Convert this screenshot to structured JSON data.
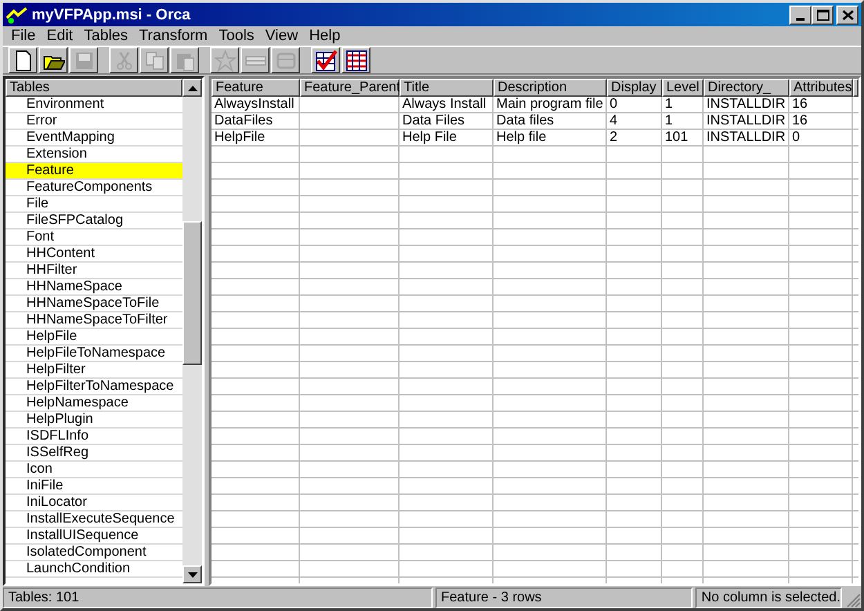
{
  "window": {
    "title": "myVFPApp.msi - Orca"
  },
  "menu": [
    "File",
    "Edit",
    "Tables",
    "Transform",
    "Tools",
    "View",
    "Help"
  ],
  "toolbar": [
    {
      "kind": "new",
      "disabled": false
    },
    {
      "kind": "open",
      "disabled": false
    },
    {
      "kind": "save",
      "disabled": true
    },
    {
      "kind": "cut",
      "disabled": true
    },
    {
      "kind": "copy",
      "disabled": true
    },
    {
      "kind": "paste",
      "disabled": true
    },
    {
      "kind": "star",
      "disabled": true
    },
    {
      "kind": "row",
      "disabled": true
    },
    {
      "kind": "table",
      "disabled": true
    },
    {
      "kind": "validate",
      "disabled": false
    },
    {
      "kind": "merge",
      "disabled": false
    }
  ],
  "tables": {
    "header": "Tables",
    "items": [
      {
        "name": "Environment",
        "selected": false
      },
      {
        "name": "Error",
        "selected": false
      },
      {
        "name": "EventMapping",
        "selected": false
      },
      {
        "name": "Extension",
        "selected": false
      },
      {
        "name": "Feature",
        "selected": true
      },
      {
        "name": "FeatureComponents",
        "selected": false
      },
      {
        "name": "File",
        "selected": false
      },
      {
        "name": "FileSFPCatalog",
        "selected": false
      },
      {
        "name": "Font",
        "selected": false
      },
      {
        "name": "HHContent",
        "selected": false
      },
      {
        "name": "HHFilter",
        "selected": false
      },
      {
        "name": "HHNameSpace",
        "selected": false
      },
      {
        "name": "HHNameSpaceToFile",
        "selected": false
      },
      {
        "name": "HHNameSpaceToFilter",
        "selected": false
      },
      {
        "name": "HelpFile",
        "selected": false
      },
      {
        "name": "HelpFileToNamespace",
        "selected": false
      },
      {
        "name": "HelpFilter",
        "selected": false
      },
      {
        "name": "HelpFilterToNamespace",
        "selected": false
      },
      {
        "name": "HelpNamespace",
        "selected": false
      },
      {
        "name": "HelpPlugin",
        "selected": false
      },
      {
        "name": "ISDFLInfo",
        "selected": false
      },
      {
        "name": "ISSelfReg",
        "selected": false
      },
      {
        "name": "Icon",
        "selected": false
      },
      {
        "name": "IniFile",
        "selected": false
      },
      {
        "name": "IniLocator",
        "selected": false
      },
      {
        "name": "InstallExecuteSequence",
        "selected": false
      },
      {
        "name": "InstallUISequence",
        "selected": false
      },
      {
        "name": "IsolatedComponent",
        "selected": false
      },
      {
        "name": "LaunchCondition",
        "selected": false
      }
    ]
  },
  "table": {
    "columns": [
      "Feature",
      "Feature_Parent",
      "Title",
      "Description",
      "Display",
      "Level",
      "Directory_",
      "Attributes"
    ],
    "rows": [
      [
        "AlwaysInstall",
        "",
        "Always Install",
        "Main program file",
        "0",
        "1",
        "INSTALLDIR",
        "16"
      ],
      [
        "DataFiles",
        "",
        "Data Files",
        "Data files",
        "4",
        "1",
        "INSTALLDIR",
        "16"
      ],
      [
        "HelpFile",
        "",
        "Help File",
        "Help file",
        "2",
        "101",
        "INSTALLDIR",
        "0"
      ]
    ]
  },
  "status_bar": [
    "Tables: 101",
    "Feature - 3 rows",
    "No column is selected."
  ]
}
